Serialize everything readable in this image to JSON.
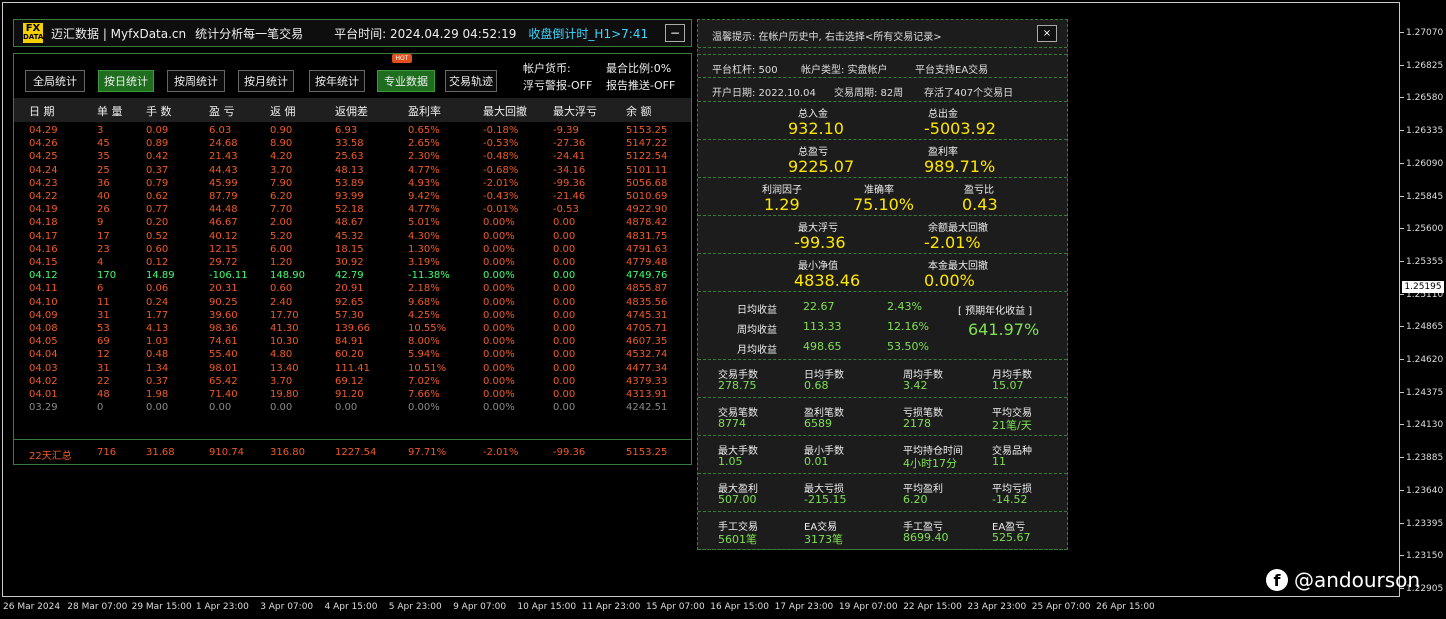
{
  "header": {
    "logo_top": "FX",
    "logo_bottom": "DATA",
    "brand": "迈汇数据 | MyfxData.cn",
    "slogan": "统计分析每一笔交易",
    "platform_time": "平台时间: 2024.04.29 04:52:19",
    "countdown": "收盘倒计时_H1>7:41",
    "minimize_label": "−"
  },
  "tabs": [
    {
      "label": "全局统计",
      "active": false
    },
    {
      "label": "按日统计",
      "active": true
    },
    {
      "label": "按周统计",
      "active": false
    },
    {
      "label": "按月统计",
      "active": false
    },
    {
      "label": "按年统计",
      "active": false
    },
    {
      "label": "专业数据",
      "active": true
    },
    {
      "label": "交易轨迹",
      "active": false
    }
  ],
  "hot_badge": "HOT",
  "account": {
    "currency": "帐户货币:",
    "float_alert": "浮亏警报-OFF",
    "close_ratio": "最合比例:0%",
    "report_push": "报告推送-OFF"
  },
  "columns": [
    "日 期",
    "单 量",
    "手 数",
    "盈 亏",
    "返 佣",
    "返佣差",
    "盈利率",
    "最大回撤",
    "最大浮亏",
    "余 额"
  ],
  "rows": [
    [
      "04.29",
      "3",
      "0.09",
      "6.03",
      "0.90",
      "6.93",
      "0.65%",
      "-0.18%",
      "-9.39",
      "5153.25"
    ],
    [
      "04.26",
      "45",
      "0.89",
      "24.68",
      "8.90",
      "33.58",
      "2.65%",
      "-0.53%",
      "-27.36",
      "5147.22"
    ],
    [
      "04.25",
      "35",
      "0.42",
      "21.43",
      "4.20",
      "25.63",
      "2.30%",
      "-0.48%",
      "-24.41",
      "5122.54"
    ],
    [
      "04.24",
      "25",
      "0.37",
      "44.43",
      "3.70",
      "48.13",
      "4.77%",
      "-0.68%",
      "-34.16",
      "5101.11"
    ],
    [
      "04.23",
      "36",
      "0.79",
      "45.99",
      "7.90",
      "53.89",
      "4.93%",
      "-2.01%",
      "-99.36",
      "5056.68"
    ],
    [
      "04.22",
      "40",
      "0.62",
      "87.79",
      "6.20",
      "93.99",
      "9.42%",
      "-0.43%",
      "-21.46",
      "5010.69"
    ],
    [
      "04.19",
      "26",
      "0.77",
      "44.48",
      "7.70",
      "52.18",
      "4.77%",
      "-0.01%",
      "-0.53",
      "4922.90"
    ],
    [
      "04.18",
      "9",
      "0.20",
      "46.67",
      "2.00",
      "48.67",
      "5.01%",
      "0.00%",
      "0.00",
      "4878.42"
    ],
    [
      "04.17",
      "17",
      "0.52",
      "40.12",
      "5.20",
      "45.32",
      "4.30%",
      "0.00%",
      "0.00",
      "4831.75"
    ],
    [
      "04.16",
      "23",
      "0.60",
      "12.15",
      "6.00",
      "18.15",
      "1.30%",
      "0.00%",
      "0.00",
      "4791.63"
    ],
    [
      "04.15",
      "4",
      "0.12",
      "29.72",
      "1.20",
      "30.92",
      "3.19%",
      "0.00%",
      "0.00",
      "4779.48"
    ],
    [
      "04.12",
      "170",
      "14.89",
      "-106.11",
      "148.90",
      "42.79",
      "-11.38%",
      "0.00%",
      "0.00",
      "4749.76"
    ],
    [
      "04.11",
      "6",
      "0.06",
      "20.31",
      "0.60",
      "20.91",
      "2.18%",
      "0.00%",
      "0.00",
      "4855.87"
    ],
    [
      "04.10",
      "11",
      "0.24",
      "90.25",
      "2.40",
      "92.65",
      "9.68%",
      "0.00%",
      "0.00",
      "4835.56"
    ],
    [
      "04.09",
      "31",
      "1.77",
      "39.60",
      "17.70",
      "57.30",
      "4.25%",
      "0.00%",
      "0.00",
      "4745.31"
    ],
    [
      "04.08",
      "53",
      "4.13",
      "98.36",
      "41.30",
      "139.66",
      "10.55%",
      "0.00%",
      "0.00",
      "4705.71"
    ],
    [
      "04.05",
      "69",
      "1.03",
      "74.61",
      "10.30",
      "84.91",
      "8.00%",
      "0.00%",
      "0.00",
      "4607.35"
    ],
    [
      "04.04",
      "12",
      "0.48",
      "55.40",
      "4.80",
      "60.20",
      "5.94%",
      "0.00%",
      "0.00",
      "4532.74"
    ],
    [
      "04.03",
      "31",
      "1.34",
      "98.01",
      "13.40",
      "111.41",
      "10.51%",
      "0.00%",
      "0.00",
      "4477.34"
    ],
    [
      "04.02",
      "22",
      "0.37",
      "65.42",
      "3.70",
      "69.12",
      "7.02%",
      "0.00%",
      "0.00",
      "4379.33"
    ],
    [
      "04.01",
      "48",
      "1.98",
      "71.40",
      "19.80",
      "91.20",
      "7.66%",
      "0.00%",
      "0.00",
      "4313.91"
    ],
    [
      "03.29",
      "0",
      "0.00",
      "0.00",
      "0.00",
      "0.00",
      "0.00%",
      "0.00%",
      "0.00",
      "4242.51"
    ]
  ],
  "row_styles": [
    "neg",
    "neg",
    "neg",
    "neg",
    "neg",
    "neg",
    "neg",
    "neg",
    "neg",
    "neg",
    "neg",
    "pos",
    "neg",
    "neg",
    "neg",
    "neg",
    "neg",
    "neg",
    "neg",
    "neg",
    "neg",
    "zero"
  ],
  "summary": [
    "22天汇总",
    "716",
    "31.68",
    "910.74",
    "316.80",
    "1227.54",
    "97.71%",
    "-2.01%",
    "-99.36",
    "5153.25"
  ],
  "right_panel": {
    "tip": "温馨提示: 在帐户历史中, 右击选择<所有交易记录>",
    "close_label": "×",
    "leverage": "平台杠杆: 500",
    "account_type": "帐户类型: 实盘帐户",
    "ea_support": "平台支持EA交易",
    "open_date": "开户日期: 2022.10.04",
    "trade_period": "交易周期: 82周",
    "stored": "存活了407个交易日",
    "total_deposit_label": "总入金",
    "total_deposit": "932.10",
    "total_withdraw_label": "总出金",
    "total_withdraw": "-5003.92",
    "total_pl_label": "总盈亏",
    "total_pl": "9225.07",
    "profit_rate_label": "盈利率",
    "profit_rate": "989.71%",
    "profit_factor_label": "利润因子",
    "profit_factor": "1.29",
    "accuracy_label": "准确率",
    "accuracy": "75.10%",
    "pl_ratio_label": "盈亏比",
    "pl_ratio": "0.43",
    "max_float_label": "最大浮亏",
    "max_float": "-99.36",
    "max_dd_label": "余额最大回撤",
    "max_dd": "-2.01%",
    "min_equity_label": "最小净值",
    "min_equity": "4838.46",
    "principal_dd_label": "本金最大回撤",
    "principal_dd": "0.00%",
    "daily_label": "日均收益",
    "daily_val": "22.67",
    "daily_pct": "2.43%",
    "weekly_label": "周均收益",
    "weekly_val": "113.33",
    "weekly_pct": "12.16%",
    "monthly_label": "月均收益",
    "monthly_val": "498.65",
    "monthly_pct": "53.50%",
    "annual_label": "[ 预期年化收益 ]",
    "annual_val": "641.97%",
    "grid": [
      [
        [
          "交易手数",
          "278.75"
        ],
        [
          "日均手数",
          "0.68"
        ],
        [
          "周均手数",
          "3.42"
        ],
        [
          "月均手数",
          "15.07"
        ]
      ],
      [
        [
          "交易笔数",
          "8774"
        ],
        [
          "盈利笔数",
          "6589"
        ],
        [
          "亏损笔数",
          "2178"
        ],
        [
          "平均交易",
          "21笔/天"
        ]
      ],
      [
        [
          "最大手数",
          "1.05"
        ],
        [
          "最小手数",
          "0.01"
        ],
        [
          "平均持仓时间",
          "4小时17分"
        ],
        [
          "交易品种",
          "11"
        ]
      ],
      [
        [
          "最大盈利",
          "507.00"
        ],
        [
          "最大亏损",
          "-215.15"
        ],
        [
          "平均盈利",
          "6.20"
        ],
        [
          "平均亏损",
          "-14.52"
        ]
      ],
      [
        [
          "手工交易",
          "5601笔"
        ],
        [
          "EA交易",
          "3173笔"
        ],
        [
          "手工盈亏",
          "8699.40"
        ],
        [
          "EA盈亏",
          "525.67"
        ]
      ]
    ]
  },
  "price_axis": [
    "1.27070",
    "1.26825",
    "1.26580",
    "1.26335",
    "1.26090",
    "1.25845",
    "1.25600",
    "1.25355",
    "1.25110",
    "1.24865",
    "1.24620",
    "1.24375",
    "1.24130",
    "1.23885",
    "1.23640",
    "1.23395",
    "1.23150",
    "1.22905"
  ],
  "current_price": "1.25195",
  "time_axis": [
    "26 Mar 2024",
    "28 Mar 07:00",
    "29 Mar 15:00",
    "1 Apr 23:00",
    "3 Apr 07:00",
    "4 Apr 15:00",
    "5 Apr 23:00",
    "9 Apr 07:00",
    "10 Apr 15:00",
    "11 Apr 23:00",
    "15 Apr 07:00",
    "16 Apr 15:00",
    "17 Apr 23:00",
    "19 Apr 07:00",
    "22 Apr 15:00",
    "23 Apr 23:00",
    "25 Apr 07:00",
    "26 Apr 15:00"
  ],
  "watermark": "@andourson",
  "watermark_icon": "facebook-icon"
}
